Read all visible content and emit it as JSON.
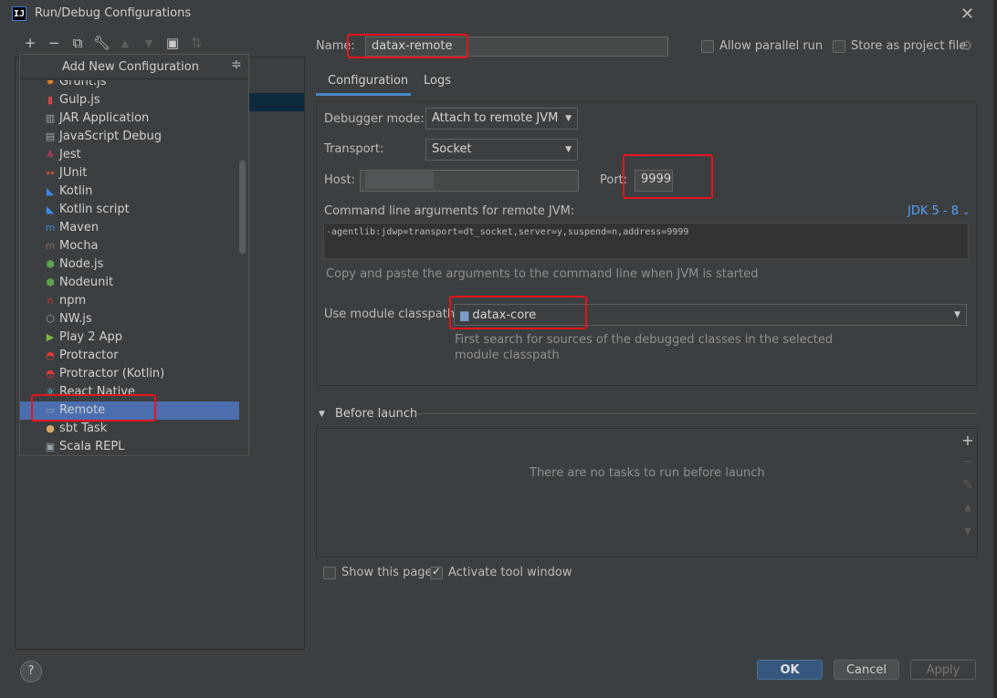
{
  "window": {
    "title": "Run/Debug Configurations",
    "logo": "IJ"
  },
  "toolbar": {
    "icons": [
      "add-icon",
      "remove-icon",
      "copy-icon",
      "wrench-icon",
      "move-up-icon",
      "move-down-icon",
      "new-folder-icon",
      "sort-icon"
    ]
  },
  "popup": {
    "title": "Add New Configuration",
    "items": [
      {
        "label": "Grunt.js",
        "icon": "grunt-icon",
        "color": "#e48632"
      },
      {
        "label": "Gulp.js",
        "icon": "gulp-icon",
        "color": "#cf4646"
      },
      {
        "label": "JAR Application",
        "icon": "jar-icon",
        "color": "#9aa7b0"
      },
      {
        "label": "JavaScript Debug",
        "icon": "js-debug-icon",
        "color": "#9aa7b0"
      },
      {
        "label": "Jest",
        "icon": "jest-icon",
        "color": "#99425b"
      },
      {
        "label": "JUnit",
        "icon": "junit-icon",
        "color": "#e0542b"
      },
      {
        "label": "Kotlin",
        "icon": "kotlin-icon",
        "color": "#3d89e5"
      },
      {
        "label": "Kotlin script",
        "icon": "kotlin-script-icon",
        "color": "#3d89e5"
      },
      {
        "label": "Maven",
        "icon": "maven-icon",
        "color": "#3d89e5"
      },
      {
        "label": "Mocha",
        "icon": "mocha-icon",
        "color": "#8d6e63"
      },
      {
        "label": "Node.js",
        "icon": "nodejs-icon",
        "color": "#5fa04e"
      },
      {
        "label": "Nodeunit",
        "icon": "nodeunit-icon",
        "color": "#5fa04e"
      },
      {
        "label": "npm",
        "icon": "npm-icon",
        "color": "#cb3837"
      },
      {
        "label": "NW.js",
        "icon": "nwjs-icon",
        "color": "#9aa7b0"
      },
      {
        "label": "Play 2 App",
        "icon": "play-icon",
        "color": "#7cb342"
      },
      {
        "label": "Protractor",
        "icon": "protractor-icon",
        "color": "#e53935"
      },
      {
        "label": "Protractor (Kotlin)",
        "icon": "protractor-kotlin-icon",
        "color": "#e53935"
      },
      {
        "label": "React Native",
        "icon": "react-icon",
        "color": "#61dafb"
      },
      {
        "label": "Remote",
        "icon": "remote-icon",
        "color": "#9aa7b0"
      },
      {
        "label": "sbt Task",
        "icon": "sbt-icon",
        "color": "#d7a66b"
      },
      {
        "label": "Scala REPL",
        "icon": "scala-repl-icon",
        "color": "#9aa7b0"
      }
    ],
    "selected_index": 18
  },
  "name_row": {
    "label": "Name:",
    "value": "datax-remote",
    "allow_parallel": "Allow parallel run",
    "store_project": "Store as project file"
  },
  "tabs": [
    {
      "label": "Configuration",
      "active": true
    },
    {
      "label": "Logs",
      "active": false
    }
  ],
  "config": {
    "debugger_mode_label": "Debugger mode:",
    "debugger_mode_value": "Attach to remote JVM",
    "transport_label": "Transport:",
    "transport_value": "Socket",
    "host_label": "Host:",
    "host_value": "",
    "port_label": "Port:",
    "port_value": "9999",
    "cmd_label": "Command line arguments for remote JVM:",
    "jdk_label": "JDK 5 - 8",
    "cmd_value": "-agentlib:jdwp=transport=dt_socket,server=y,suspend=n,address=9999",
    "cmd_hint": "Copy and paste the arguments to the command line when JVM is started",
    "module_label": "Use module classpath:",
    "module_value": "datax-core",
    "module_hint_1": "First search for sources of the debugged classes in the selected",
    "module_hint_2": "module classpath"
  },
  "before_launch": {
    "title": "Before launch",
    "empty_text": "There are no tasks to run before launch"
  },
  "footer": {
    "show_page": "Show this page",
    "show_page_checked": false,
    "activate_tool": "Activate tool window",
    "activate_tool_checked": true,
    "help": "?",
    "ok": "OK",
    "cancel": "Cancel",
    "apply": "Apply"
  },
  "colors": {
    "accent": "#4b6eaf",
    "highlight": "#e8141a",
    "link": "#589df6"
  }
}
